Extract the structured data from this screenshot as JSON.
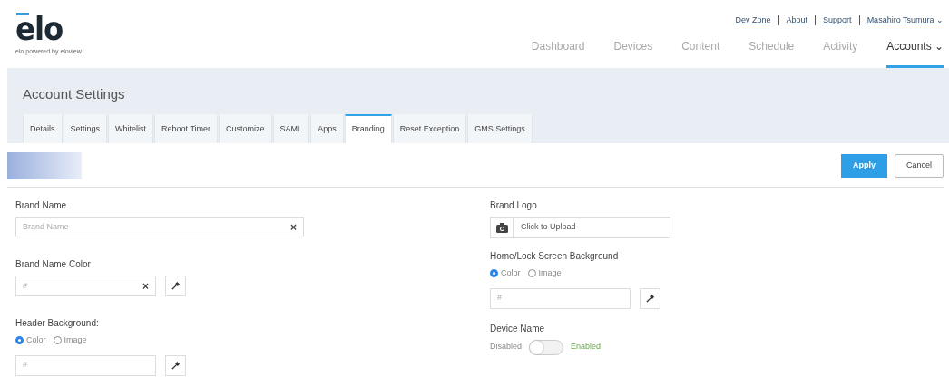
{
  "logo": {
    "wordmark": "elo",
    "tagline": "elo powered by eloview"
  },
  "top_links": [
    "Dev Zone",
    "About",
    "Support"
  ],
  "user_menu": {
    "label": "Masahiro Tsumura",
    "caret": "⌄"
  },
  "main_nav": [
    {
      "label": "Dashboard",
      "selected": false
    },
    {
      "label": "Devices",
      "selected": false
    },
    {
      "label": "Content",
      "selected": false
    },
    {
      "label": "Schedule",
      "selected": false
    },
    {
      "label": "Activity",
      "selected": false
    },
    {
      "label": "Accounts",
      "selected": true,
      "caret": "⌄"
    }
  ],
  "page_title": "Account Settings",
  "tabs": [
    {
      "label": "Details",
      "selected": false
    },
    {
      "label": "Settings",
      "selected": false
    },
    {
      "label": "Whitelist",
      "selected": false
    },
    {
      "label": "Reboot Timer",
      "selected": false
    },
    {
      "label": "Customize",
      "selected": false
    },
    {
      "label": "SAML",
      "selected": false
    },
    {
      "label": "Apps",
      "selected": false
    },
    {
      "label": "Branding",
      "selected": true
    },
    {
      "label": "Reset Exception",
      "selected": false
    },
    {
      "label": "GMS Settings",
      "selected": false
    }
  ],
  "actions": [
    {
      "label": "Apply",
      "kind": "primary"
    },
    {
      "label": "Cancel",
      "kind": "secondary"
    }
  ],
  "left_fields": [
    {
      "kind": "text",
      "label": "Brand Name",
      "placeholder": "Brand Name",
      "clear": "×"
    },
    {
      "kind": "color",
      "label": "Brand Name Color",
      "placeholder": "#",
      "clear": "×"
    },
    {
      "kind": "color_choice",
      "label": "Header Background:",
      "options": [
        {
          "label": "Color",
          "selected": true
        },
        {
          "label": "Image",
          "selected": false
        }
      ],
      "placeholder": "#"
    }
  ],
  "right_fields": [
    {
      "kind": "upload",
      "label": "Brand Logo",
      "placeholder": "Click to Upload"
    },
    {
      "kind": "color_choice",
      "label": "Home/Lock Screen Background",
      "options": [
        {
          "label": "Color",
          "selected": true
        },
        {
          "label": "Image",
          "selected": false
        }
      ],
      "placeholder": "#"
    },
    {
      "kind": "toggle",
      "label": "Device Name",
      "off_label": "Disabled",
      "on_label": "Enabled",
      "on": false
    }
  ]
}
